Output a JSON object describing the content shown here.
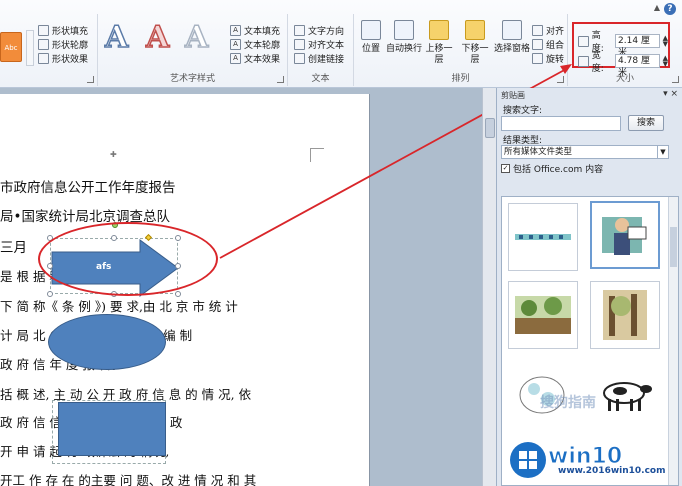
{
  "ribbon": {
    "abc_label": "Abc",
    "shape_styles": [
      "形状填充",
      "形状轮廓",
      "形状效果"
    ],
    "wordart_letter": "A",
    "text_fill": [
      "文本填充",
      "文本轮廓",
      "文本效果"
    ],
    "group_wordart": "艺术字样式",
    "text_cmds": [
      "文字方向",
      "对齐文本",
      "创建链接"
    ],
    "group_text": "文本",
    "arrange_btns": [
      "位置",
      "自动换行",
      "上移一层",
      "下移一层",
      "选择窗格"
    ],
    "arrange_small": [
      "对齐",
      "组合",
      "旋转"
    ],
    "group_arrange": "排列",
    "size": {
      "height_label": "高度:",
      "height_value": "2.14 厘米",
      "width_label": "宽度:",
      "width_value": "4.78 厘米",
      "group_label": "大小"
    }
  },
  "document": {
    "lines": [
      "市政府信息公开工作年度报告",
      "局•国家统计局北京调查总队",
      "三月",
      "是  根  据                          和  国  政  府  信  息  公",
      "下 简 称《 条 例 》) 要 求,由 北 京 市 统 计",
      "计  局  北                     (以下简称统计局队) 编  制",
      "政  府  信                  年  度  报  告。",
      "括  概  述, 主  动  公  开  政  府  信  息  的  情  况,  依",
      "政  府  信                      信息公开咨询情况,因  政",
      "开  申  请                      起  行  政诉讼  的  情况,",
      "开工 作 存 在 的主要 问 题、改 进 情 况 和 其"
    ],
    "arrow_text": "afs"
  },
  "clip_pane": {
    "title": "剪贴画",
    "close": "▾ ×",
    "search_label": "搜索文字:",
    "search_value": "",
    "search_button": "搜索",
    "result_type_label": "结果类型:",
    "result_type_value": "所有媒体文件类型",
    "include_office": "包括 Office.com 内容",
    "checked": "✓"
  },
  "watermark": {
    "title": "win10之家",
    "url": "www.2016win10.com",
    "sogou": "搜狗指南"
  },
  "colors": {
    "accent_red": "#d9262a",
    "shape_blue": "#4f81bd"
  }
}
